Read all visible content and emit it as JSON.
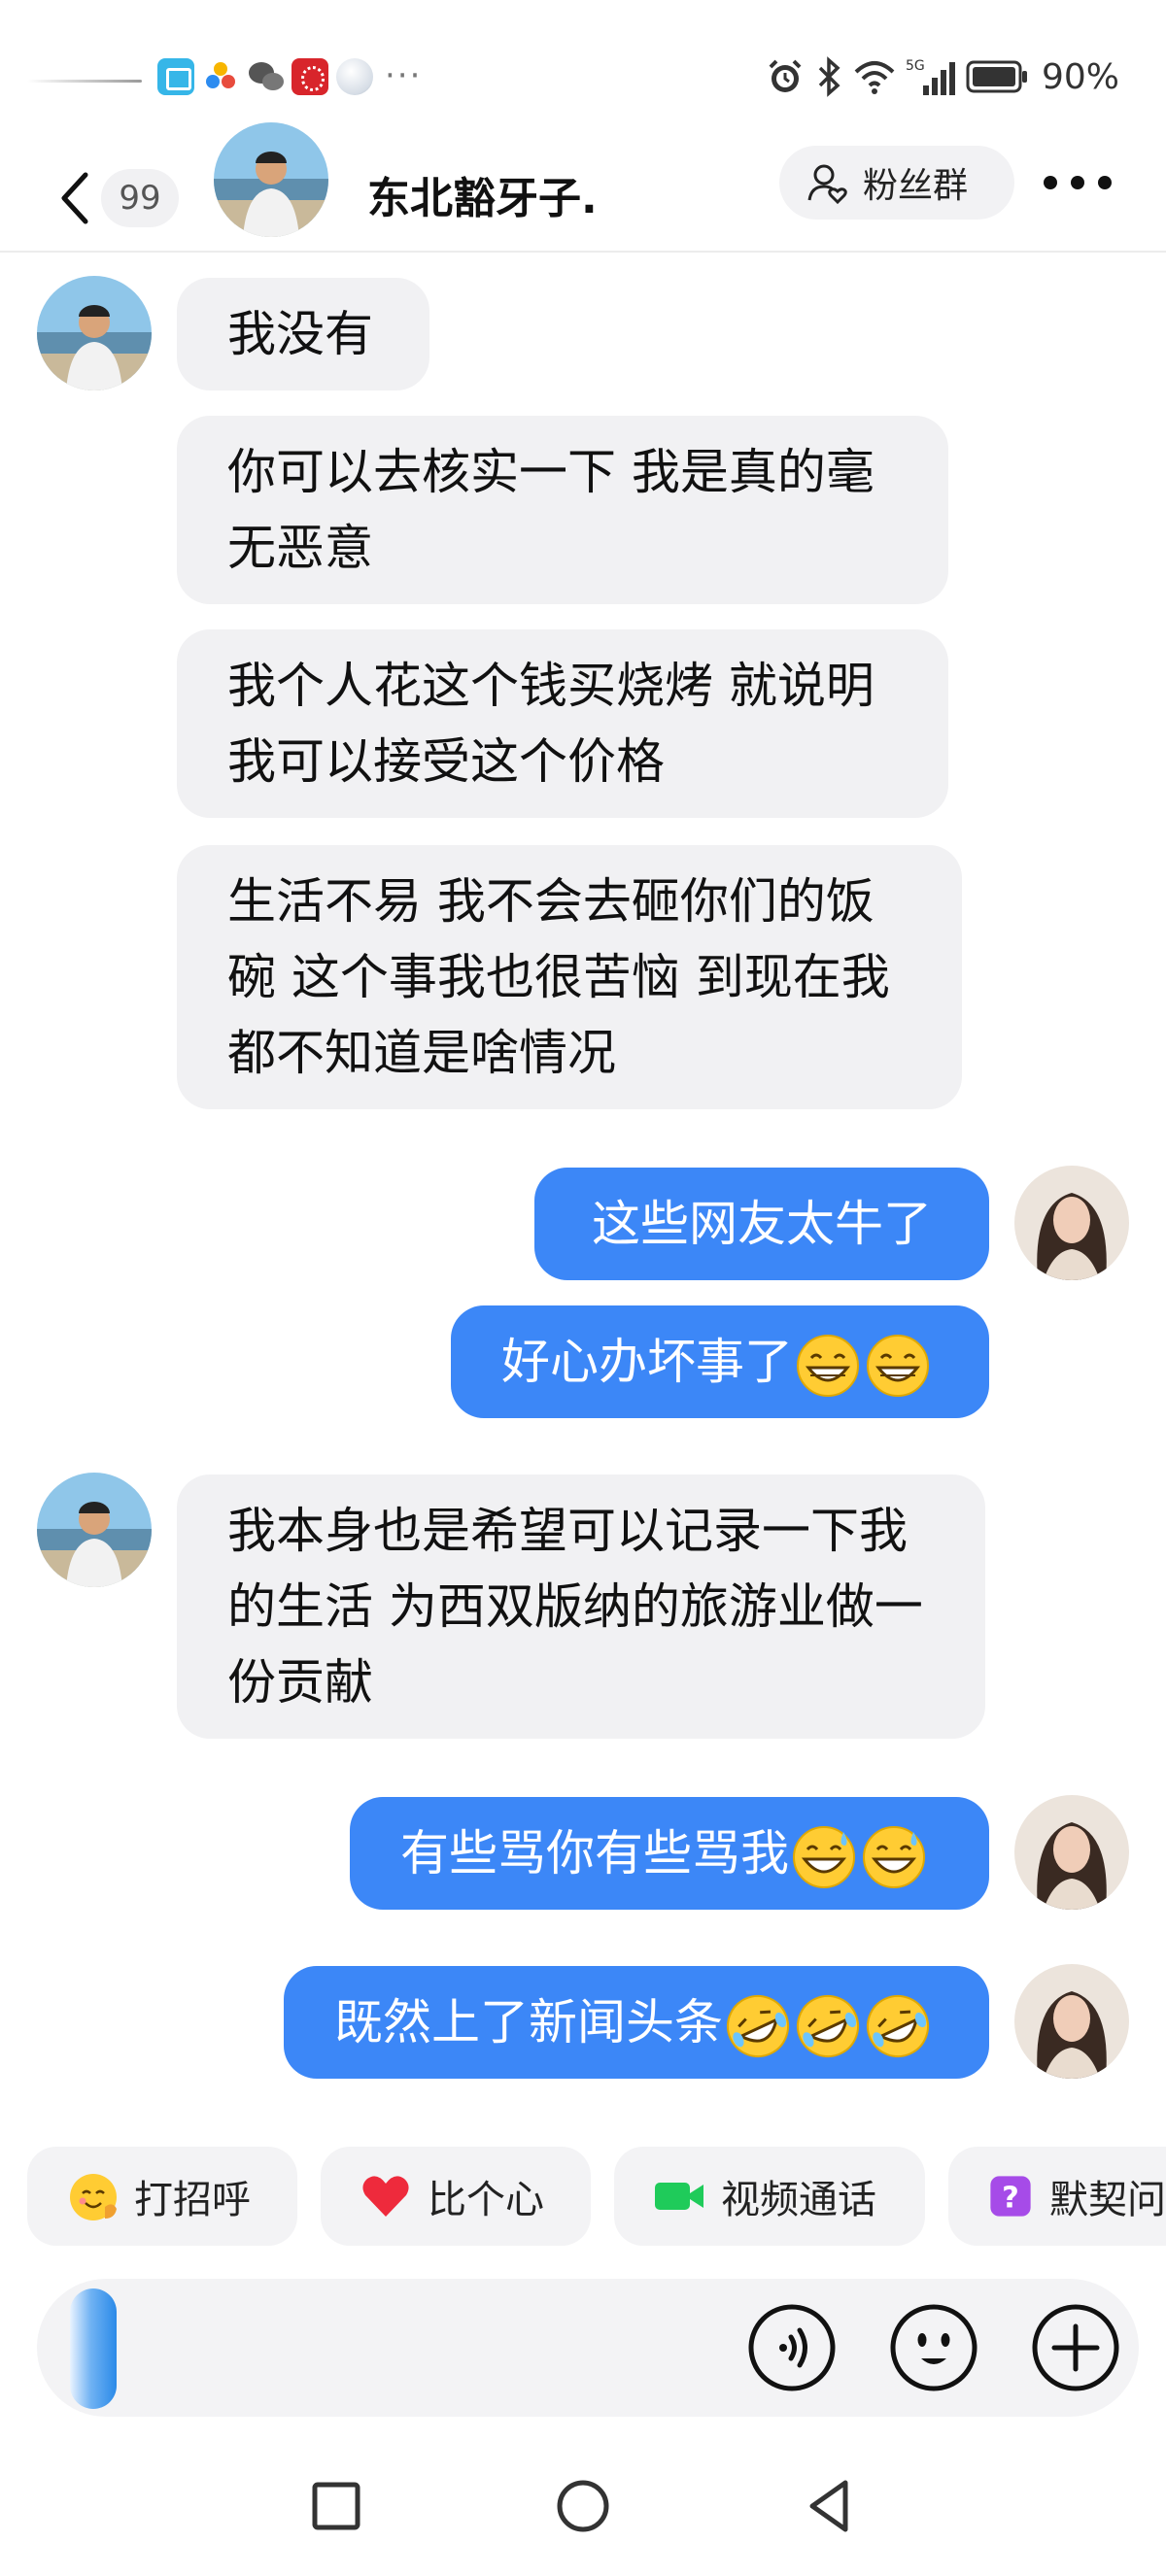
{
  "status_bar": {
    "network_label": "5G",
    "battery": "90%"
  },
  "header": {
    "back_icon": "chevron-left-icon",
    "unread_count": "99",
    "contact_name": "东北豁牙子.",
    "fans_group_label": "粉丝群",
    "more_icon": "more-dots-icon"
  },
  "messages": [
    {
      "side": "in",
      "text": "我没有",
      "show_avatar": true
    },
    {
      "side": "in",
      "text": "你可以去核实一下 我是真的毫无恶意",
      "show_avatar": false
    },
    {
      "side": "in",
      "text": "我个人花这个钱买烧烤 就说明我可以接受这个价格",
      "show_avatar": false
    },
    {
      "side": "in",
      "text": "生活不易 我不会去砸你们的饭碗 这个事我也很苦恼 到现在我都不知道是啥情况",
      "show_avatar": false
    },
    {
      "side": "out",
      "text": "这些网友太牛了",
      "emojis": [],
      "show_avatar": true
    },
    {
      "side": "out",
      "text": "好心办坏事了",
      "emojis": [
        "grin",
        "grin"
      ],
      "show_avatar": false
    },
    {
      "side": "in",
      "text": "我本身也是希望可以记录一下我的生活 为西双版纳的旅游业做一份贡献",
      "show_avatar": true
    },
    {
      "side": "out",
      "text": "有些骂你有些骂我",
      "emojis": [
        "sweat-smile",
        "sweat-smile"
      ],
      "show_avatar": true
    },
    {
      "side": "out",
      "text": "既然上了新闻头条",
      "emojis": [
        "rofl",
        "rofl",
        "rofl"
      ],
      "show_avatar": true
    }
  ],
  "quick_actions": [
    {
      "label": "打招呼",
      "icon": "wave-face-icon"
    },
    {
      "label": "比个心",
      "icon": "heart-icon"
    },
    {
      "label": "视频通话",
      "icon": "video-camera-icon"
    },
    {
      "label": "默契问",
      "icon": "question-box-icon"
    }
  ],
  "input_bar": {
    "placeholder": "",
    "voice_icon": "voice-icon",
    "emoji_icon": "emoji-icon",
    "plus_icon": "plus-icon"
  },
  "nav_bar": {
    "recent_icon": "square-icon",
    "home_icon": "circle-icon",
    "back_icon": "triangle-back-icon"
  },
  "colors": {
    "outgoing_bubble": "#3c87f7",
    "incoming_bubble": "#f1f1f3",
    "chip_bg": "#f3f3f5"
  }
}
